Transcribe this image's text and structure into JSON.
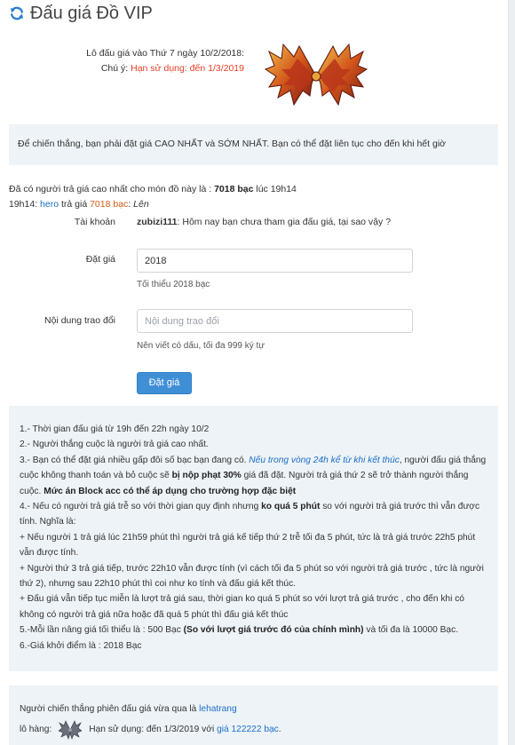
{
  "header": {
    "icon": "refresh-icon",
    "title": "Đấu giá Đồ VIP"
  },
  "lot": {
    "line1": "Lô đấu giá vào Thứ 7 ngày 10/2/2018:",
    "note_label": "Chú ý:",
    "note_value": "Hạn sử dụng: đến 1/3/2019",
    "item_icon": "winged-item-art"
  },
  "alert": {
    "text": "Để chiến thắng, bạn phải đặt giá CAO NHẤT và SỚM NHẤT. Bạn có thể đặt liên tục cho đến khi hết giờ"
  },
  "highest": {
    "prefix": "Đã có người trả giá cao nhất cho món đồ này là :",
    "amount": "7018 bạc",
    "suffix": "lúc 19h14",
    "log_time": "19h14:",
    "log_user": "hero",
    "log_mid": "trả giá",
    "log_amount": "7018 bạc",
    "log_sep": ":",
    "log_status": "Lên"
  },
  "form": {
    "account_label": "Tài khoản",
    "account_name": "zubizi111",
    "account_msg": ": Hôm nay bạn chưa tham gia đấu giá, tại sao vậy ?",
    "bid_label": "Đặt giá",
    "bid_value": "2018",
    "bid_hint": "Tối thiểu 2018 bạc",
    "content_label": "Nội dung trao đổi",
    "content_placeholder": "Nội dung trao đổi",
    "content_hint": "Nên viết có dấu, tối đa 999 ký tự",
    "submit_label": "Đặt giá"
  },
  "rules": {
    "r1": "1.- Thời gian đấu giá từ 19h đến 22h ngày 10/2",
    "r2": "2.- Người thắng cuộc là người trả giá cao nhất.",
    "r3a": "3.- Bạn có thể đặt giá nhiều gấp đôi số bạc bạn đang có.",
    "r3b": "Nếu trong vòng 24h kể từ khi kết thúc",
    "r3c": ", người đấu giá thắng cuộc không thanh toán và bỏ cuộc sẽ",
    "r3d": "bị nộp phạt 30%",
    "r3e": "giá đã đặt. Người trả giá thứ 2 sẽ trở thành người thắng cuộc.",
    "r3f": "Mức án Block acc có thể áp dụng cho trường hợp đặc biệt",
    "r4a": "4.- Nếu có người trả giá trễ so với thời gian quy định nhưng",
    "r4b": "ko quá 5 phút",
    "r4c": "so với người trả giá trước thì vẫn được tính. Nghĩa là:",
    "r4d": "+ Nếu người 1 trả giá lúc 21h59 phút thì người trả giá kế tiếp thứ 2 trễ tối đa 5 phút, tức là trả giá trước 22h5 phút vẫn được tính.",
    "r4e": "+ Người thứ 3 trả giá tiếp, trước 22h10 vẫn được tính (vì cách tối đa 5 phút so với người trả giá trước , tức là người thứ 2), nhưng sau 22h10 phút thì coi như ko tính và đấu giá kết thúc.",
    "r4f": "+ Đấu giá vẫn tiếp tục miễn là lượt trả giá sau, thời gian ko quá 5 phút so với lượt trả giá trước , cho đến khi có không có người trả giá nữa hoặc đã quá 5 phút thì đấu giá kết thúc",
    "r5a": "5.-Mỗi lần nâng giá tối thiểu là : 500 Bạc",
    "r5b": "(So với lượt giá trước đó của chính mình)",
    "r5c": "và tối đa là 10000 Bạc.",
    "r6": "6.-Giá khởi điểm là : 2018 Bạc"
  },
  "winner": {
    "prefix": "Người chiến thắng phiên đấu giá vừa qua là",
    "name": "lehatrang",
    "lot_label": "lô hàng:",
    "lot_icon": "winged-item-thumb",
    "expiry": "Hạn sử dụng: đến 1/3/2019 với",
    "price": "giá 122222 bạc",
    "end": "."
  },
  "colors": {
    "accent": "#3f8fd6",
    "link": "#1a6fc7",
    "warning": "#e8402a",
    "amount": "#d35e1b",
    "panel_bg": "#eef3f7"
  }
}
